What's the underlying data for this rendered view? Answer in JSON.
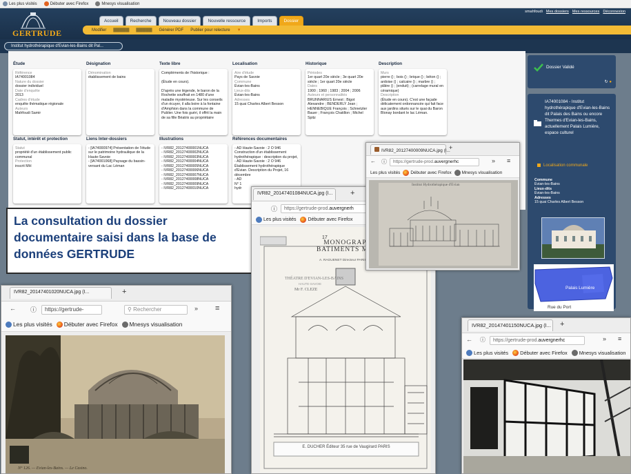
{
  "browser_bookmarks": [
    "Les plus visités",
    "Débuter avec Firefox",
    "Mnesys visualisation"
  ],
  "app": {
    "logo": "GERTRUDE",
    "tabs": [
      {
        "label": "Accueil",
        "active": false
      },
      {
        "label": "Recherche",
        "active": false
      },
      {
        "label": "Nouveau dossier",
        "active": false
      },
      {
        "label": "Nouvelle ressource",
        "active": false
      },
      {
        "label": "Imports",
        "active": false
      },
      {
        "label": "Dossier",
        "active": true
      }
    ],
    "user_links": [
      "smahfoudi",
      "Mes dossiers",
      "Mes ressources",
      "Déconnexion"
    ],
    "subbar": {
      "modifier": "Modifier",
      "pdf": "Générer PDF",
      "relecture": "Publier pour relecture"
    },
    "dossier_title": "Institut hydrothérapique d'Evian-les-Bains dit Pal..."
  },
  "sections": {
    "etude": {
      "title": "Étude",
      "lines": [
        [
          "Référence",
          "lbl"
        ],
        [
          "IA74001084",
          ""
        ],
        [
          "Nature du dossier",
          "lbl"
        ],
        [
          "dossier individuel",
          ""
        ],
        [
          "Date d'enquête",
          "lbl"
        ],
        [
          "2013",
          ""
        ],
        [
          "Cadres d'étude",
          "lbl"
        ],
        [
          "enquête thématique régionale",
          ""
        ],
        [
          "Auteurs",
          "lbl"
        ],
        [
          "Mahfoudi Samir",
          ""
        ]
      ]
    },
    "designation": {
      "title": "Désignation",
      "lines": [
        [
          "Dénomination",
          "lbl"
        ],
        [
          "établissement de bains",
          ""
        ]
      ]
    },
    "texte_libre": {
      "title": "Texte libre",
      "lines": [
        [
          "Compléments de l'historique :",
          ""
        ],
        [
          "",
          ""
        ],
        [
          "(Étude en cours).",
          ""
        ],
        [
          "",
          ""
        ],
        [
          "D'après une légende, le baron de la Rochette souffrait en 1480 d'une maladie mystérieuse. Sur les conseils d'un écuyer, il alla boire à la fontaine d'Amphion dans la commune de Publier. Une fois guéri, il offrit la main de sa fille Béatrix au propriétaire",
          ""
        ]
      ]
    },
    "localisation": {
      "title": "Localisation",
      "lines": [
        [
          "Aire d'étude",
          "lbl"
        ],
        [
          "Pays de Savoie",
          ""
        ],
        [
          "Commune",
          "lbl"
        ],
        [
          "Évian-les-Bains",
          ""
        ],
        [
          "Lieux-dits",
          "lbl"
        ],
        [
          "Évian-les-Bains",
          ""
        ],
        [
          "Adresses",
          "lbl"
        ],
        [
          "15 quai Charles Albert Besson",
          ""
        ]
      ]
    },
    "historique": {
      "title": "Historique",
      "lines": [
        [
          "Périodes",
          "lbl"
        ],
        [
          "1er quart 20e siècle ; 3e quart 20e siècle ; 1er quart 20e siècle",
          ""
        ],
        [
          "Dates",
          "lbl"
        ],
        [
          "1900 ; 1960 ; 1983 ; 2004 ; 2006",
          ""
        ],
        [
          "Auteurs et personnalités",
          "lbl"
        ],
        [
          "BRUNNARIUS Ernest ; Bigot Alexandre ; BENDERLY Jean ; HENNEBIQUE François ; Schnetzler Bauer ; François Chatillon ; Michel Spitz",
          ""
        ]
      ]
    },
    "description": {
      "title": "Description",
      "lines": [
        [
          "Murs",
          "lbl"
        ],
        [
          "pierre () ; bois () ; brique () ; béton () ; ardoise () ; calcaire () ; marbre () ; plâtre () ; (enduit) ; (carrelage mural en céramique)",
          ""
        ],
        [
          "Description",
          "lbl"
        ],
        [
          "(Étude en cours). C'est une façade délicatement ordonnancée qui fait face aux jardins situés sur le quai du Baron Blonay bordant le lac Léman.",
          ""
        ]
      ]
    },
    "statut": {
      "title": "Statut, intérêt et protection",
      "lines": [
        [
          "Statut",
          "lbl"
        ],
        [
          "propriété d'un établissement public communal",
          ""
        ],
        [
          "Protection",
          "lbl"
        ],
        [
          "inscrit MH",
          ""
        ]
      ]
    },
    "liens": {
      "title": "Liens Inter-dossiers",
      "lines": [
        [
          "- [IA74000974] Présentation de l'étude sur le patrimoine hydraulique de la Haute-Savoie",
          ""
        ],
        [
          "- [IA74001068] Paysage du bassin-versant du Lac Léman",
          ""
        ]
      ]
    },
    "illustrations": {
      "title": "Illustrations",
      "lines": [
        [
          "- IVR82_20127400001NUCA",
          ""
        ],
        [
          "- IVR82_20127400002NUCA",
          ""
        ],
        [
          "- IVR82_20127400003NUCA",
          ""
        ],
        [
          "- IVR82_20127400004NUCA",
          ""
        ],
        [
          "- IVR82_20127400005NUCA",
          ""
        ],
        [
          "- IVR82_20127400006NUCA",
          ""
        ],
        [
          "- IVR82_20127400007NUCA",
          ""
        ],
        [
          "- IVR82_20127400008NUCA",
          ""
        ],
        [
          "- IVR82_20127400009NUCA",
          ""
        ],
        [
          "- IVR82_20127400010NUCA",
          ""
        ]
      ]
    },
    "references": {
      "title": "Références documentaires",
      "lines": [
        [
          "- AD Haute-Savoie : 2 O 946 Construction d'un établissement hydrothérapique : description du projet,",
          ""
        ],
        [
          "- AD Haute-Savoie : 2 O 946 Établissement hydrothérapique d'Evian. Description du Projet, 16 décembre",
          ""
        ],
        [
          "- AD",
          ""
        ],
        [
          "N° 1",
          ""
        ],
        [
          "hydr",
          ""
        ]
      ]
    }
  },
  "status": {
    "label": "Dossier Validé"
  },
  "dossier_box": {
    "title": "IA74001084 - Institut hydrothérapique d'Evian-les-Bains dit Palais des Bains ou encore Thermes d'Evian-les-Bains, actuellement Palais Lumière, espace culturel",
    "loc_title": "Localisation communale",
    "commune_label": "Commune",
    "commune": "Évian-les-Bains",
    "lieux_label": "Lieux-dits",
    "lieux": "Évian-les-Bains",
    "adresses_label": "Adresses",
    "adresse": "15 quai Charles Albert Besson",
    "map_label": "Palais Lumière",
    "map_street": "Rue du Port"
  },
  "callout": {
    "text": [
      "La consultation du dossier",
      "documentaire saisi dans la base de",
      "données GERTRUDE"
    ]
  },
  "windows": {
    "w1": {
      "tab": "IVR82_20147401020NUCA.jpg (I...",
      "url": "https://gertrude-",
      "search": "Rechercher",
      "bookmarks": [
        "Les plus visités",
        "Débuter avec Firefox",
        "Mnesys visualisation"
      ],
      "caption": "N° 126. — Evian-les-Bains. — Le Casino."
    },
    "w2": {
      "tab": "IVR82_20147401084NUCA.jpg (I...",
      "url_grey": "https://gertrude-prod.",
      "url_dark": "auvergnerh",
      "bookmarks": [
        "Les plus visités",
        "Débuter avec Firefox"
      ],
      "plate_number": "17",
      "plate_title": "MONOGRAPHIES DE BATIMENTS MODERNES",
      "plate_publisher": "A. RAGUENET Directeur PARIS",
      "plate_subtitle": "THÉATRE D'EVIAN-LES-BAINS",
      "plate_small": "HAUTE-SAVOIE",
      "plate_architect": "Mr F. CLEZE",
      "plate_footer": "E. DUCHER Éditeur 35 rue de Vaugirard PARIS"
    },
    "w3": {
      "tab": "IVR82_20127400009NUCA.jpg (I...",
      "url_grey": "https://gertrude-prod.",
      "url_dark": "auvergnerhc",
      "bookmarks": [
        "Les plus visités",
        "Débuter avec Firefox",
        "Mnesys visualisation"
      ],
      "plate_heading": "Institut Hydrothérapique d'Evian"
    },
    "w4": {
      "tab": "IVR82_20147401150NUCA.jpg (I...",
      "url_grey": "https://gertrude-prod.",
      "url_dark": "auvergnerhc",
      "bookmarks": [
        "Les plus visités",
        "Débuter avec Firefox",
        "Mnesys visualisation"
      ]
    }
  },
  "colors": {
    "brand_orange": "#f0a81a",
    "header_blue": "#1d3550",
    "panel_blue": "#2d4a6e",
    "callout_blue": "#1b3f7a",
    "valid_green": "#2fa243"
  }
}
